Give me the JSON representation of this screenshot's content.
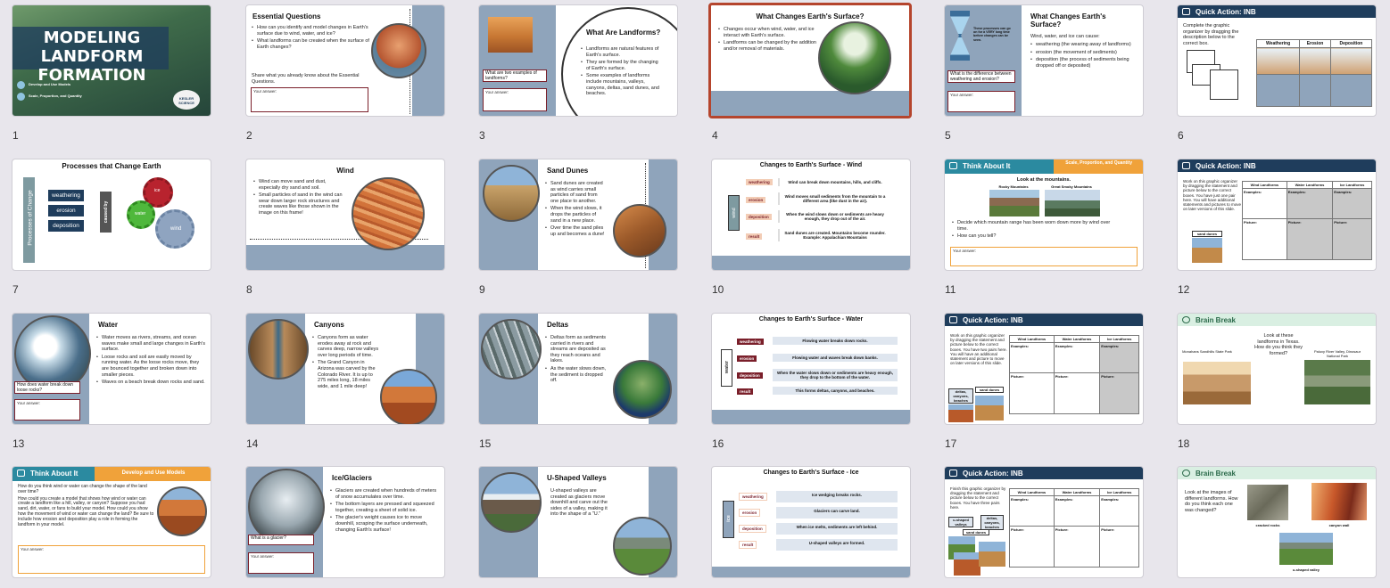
{
  "slides": [
    {
      "num": "1",
      "title": "MODELING LANDFORM FORMATION",
      "line1": "Develop and Use Models",
      "line2": "Scale, Proportion, and Quantity",
      "logo": "KESLER SCIENCE"
    },
    {
      "num": "2",
      "title": "Essential Questions",
      "bullets": [
        "How can you identify and model changes in Earth's surface due to wind, water, and ice?",
        "What landforms can be created when the surface of Earth changes?"
      ],
      "prompt": "Share what you already know about the Essential Questions.",
      "answer": "Your answer:"
    },
    {
      "num": "3",
      "title": "What Are Landforms?",
      "bullets": [
        "Landforms are natural features of Earth's surface.",
        "They are formed by the changing of Earth's surface.",
        "Some examples of landforms include mountains, valleys, canyons, deltas, sand dunes, and beaches."
      ],
      "question": "What are two examples of landforms?",
      "answer": "Your answer:"
    },
    {
      "num": "4",
      "title": "What Changes Earth's Surface?",
      "bullets": [
        "Changes occur when wind, water, and ice interact with Earth's surface.",
        "Landforms can be changed by the addition and/or removal of materials."
      ]
    },
    {
      "num": "5",
      "title": "What Changes Earth's Surface?",
      "intro": "Wind, water, and ice can cause:",
      "bullets": [
        "weathering (the wearing away of landforms)",
        "erosion (the movement of sediments)",
        "deposition (the process of sediments being dropped off or deposited)"
      ],
      "hourglass_note": "These processes can go on for a VERY long time before changes can be seen.",
      "question": "What is the difference between weathering and erosion?",
      "answer": "Your answer:"
    },
    {
      "num": "6",
      "header": "Quick Action: INB",
      "text": "Complete the graphic organizer by dragging the description below to the correct box.",
      "cols": [
        "Weathering",
        "Erosion",
        "Deposition"
      ]
    },
    {
      "num": "7",
      "title": "Processes that Change Earth",
      "side": "Processes of Change",
      "items": [
        "weathering",
        "erosion",
        "deposition"
      ],
      "caused": "caused by",
      "gears": [
        "ice",
        "water",
        "wind"
      ]
    },
    {
      "num": "8",
      "title": "Wind",
      "bullets": [
        "Wind can move sand and dust, especially dry sand and soil.",
        "Small particles of sand in the wind can wear down larger rock structures and create waves like those shown in the image on this frame!"
      ]
    },
    {
      "num": "9",
      "title": "Sand Dunes",
      "bullets": [
        "Sand dunes are created as wind carries small particles of sand from one place to another.",
        "When the wind slows, it drops the particles of sand in a new place.",
        "Over time the sand piles up and becomes a dune!"
      ]
    },
    {
      "num": "10",
      "title": "Changes to Earth's Surface - Wind",
      "side": "wind",
      "labels": [
        "weathering",
        "erosion",
        "deposition",
        "result"
      ],
      "rows": [
        "Wind can break down mountains, hills, and cliffs.",
        "Wind moves small sediments from the mountain to a different area (like dust in the air).",
        "When the wind slows down or sediments are heavy enough, they drop out of the air.",
        "Sand dunes are created. Mountains become rounder. Example: Appalachian Mountains"
      ]
    },
    {
      "num": "11",
      "header": "Think About It",
      "tag": "Scale, Proportion, and Quantity",
      "lead": "Look at the mountains.",
      "captions": [
        "Rocky Mountains",
        "Great Smoky Mountains"
      ],
      "bullets": [
        "Decide which mountain range has been worn down more by wind over time.",
        "How can you tell?"
      ],
      "answer": "Your answer:"
    },
    {
      "num": "12",
      "header": "Quick Action: INB",
      "text": "Work on this graphic organizer by dragging the statement and picture below to the correct boxes. You have just one pair here. You will have additional statements and pictures to move on later versions of this slide.",
      "cols": [
        "Wind Landforms",
        "Water Landforms",
        "Ice Landforms"
      ],
      "rowlabels": [
        "Examples:",
        "Picture:"
      ],
      "chip": "sand dunes"
    },
    {
      "num": "13",
      "title": "Water",
      "bullets": [
        "Water moves as rivers, streams, and ocean waves make small and large changes in Earth's surface.",
        "Loose rocks and soil are easily moved by running water. As the loose rocks move, they are bounced together and broken down into smaller pieces.",
        "Waves on a beach break down rocks and sand."
      ],
      "question": "How does water break down loose rocks?",
      "answer": "Your answer:"
    },
    {
      "num": "14",
      "title": "Canyons",
      "bullets": [
        "Canyons form as water erodes away at rock and carves deep, narrow valleys over long periods of time.",
        "The Grand Canyon in Arizona was carved by the Colorado River. It is up to 275 miles long, 18 miles wide, and 1 mile deep!"
      ]
    },
    {
      "num": "15",
      "title": "Deltas",
      "bullets": [
        "Deltas form as sediments carried in rivers and streams are deposited as they reach oceans and lakes.",
        "As the water slows down, the sediment is dropped off."
      ]
    },
    {
      "num": "16",
      "title": "Changes to Earth's Surface - Water",
      "side": "water",
      "labels": [
        "weathering",
        "erosion",
        "deposition",
        "result"
      ],
      "rows": [
        "Flowing water breaks down rocks.",
        "Flowing water and waves break down banks.",
        "When the water slows down or sediments are heavy enough, they drop to the bottom of the water.",
        "This forms deltas, canyons, and beaches."
      ]
    },
    {
      "num": "17",
      "header": "Quick Action: INB",
      "text": "Work on this graphic organizer by dragging the statement and picture below to the correct boxes. You have two pairs here. You will have an additional statement and picture to move on later versions of this slide.",
      "cols": [
        "Wind Landforms",
        "Water Landforms",
        "Ice Landforms"
      ],
      "rowlabels": [
        "Examples:",
        "Picture:"
      ],
      "chips": [
        "deltas, canyons, beaches",
        "sand dunes"
      ]
    },
    {
      "num": "18",
      "header": "Brain Break",
      "question": "Look at these landforms in Texas. How do you think they formed?",
      "captions": [
        "Monahans Sandhills State Park",
        "Paluxy River Valley, Dinosaur National Park"
      ]
    },
    {
      "num": "19",
      "header": "Think About It",
      "tag": "Develop and Use Models",
      "lines": [
        "How do you think wind or water can change the shape of the land over time?",
        "How could you create a model that shows how wind or water can create a landform like a hill, valley, or canyon? Suppose you had sand, dirt, water, or fans to build your model. How could you show how the movement of wind or water can change the land? Be sure to include how erosion and deposition play a role in forming the landform in your model."
      ],
      "answer": "Your answer:"
    },
    {
      "num": "20",
      "title": "Ice/Glaciers",
      "bullets": [
        "Glaciers are created when hundreds of meters of snow accumulates over time.",
        "The bottom layers are pressed and squeezed together, creating a sheet of solid ice.",
        "The glacier's weight causes ice to move downhill, scraping the surface underneath, changing Earth's surface!"
      ],
      "question": "What is a glacier?",
      "answer": "Your answer:"
    },
    {
      "num": "21",
      "title": "U-Shaped Valleys",
      "bullets": [
        "U-shaped valleys are created as glaciers move downhill and carve out the sides of a valley, making it into the shape of a \"U.\""
      ]
    },
    {
      "num": "22",
      "title": "Changes to Earth's Surface - Ice",
      "side": "ice",
      "labels": [
        "weathering",
        "erosion",
        "deposition",
        "result"
      ],
      "rows": [
        "Ice wedging breaks rocks.",
        "Glaciers can carve land.",
        "When ice melts, sediments are left behind.",
        "U-shaped valleys are formed."
      ]
    },
    {
      "num": "23",
      "header": "Quick Action: INB",
      "text": "Finish this graphic organizer by dragging the statement and picture below to the correct boxes. You have three pairs here.",
      "cols": [
        "Wind Landforms",
        "Water Landforms",
        "Ice Landforms"
      ],
      "rowlabels": [
        "Examples:",
        "Picture:"
      ],
      "chips": [
        "u-shaped valleys",
        "deltas, canyons, beaches",
        "sand dunes"
      ]
    },
    {
      "num": "24",
      "header": "Brain Break",
      "question": "Look at the images of different landforms. How do you think each one was changed?",
      "captions": [
        "cracked rocks",
        "canyon wall",
        "u-shaped valley"
      ]
    }
  ],
  "colors": {
    "selected": "#b5452d",
    "navy": "#1f3d5c",
    "maroon": "#7a1f2a",
    "band": "#8fa4bb",
    "teal": "#2b8aa0",
    "orange": "#f0a23a",
    "green": "#d9efe2"
  }
}
